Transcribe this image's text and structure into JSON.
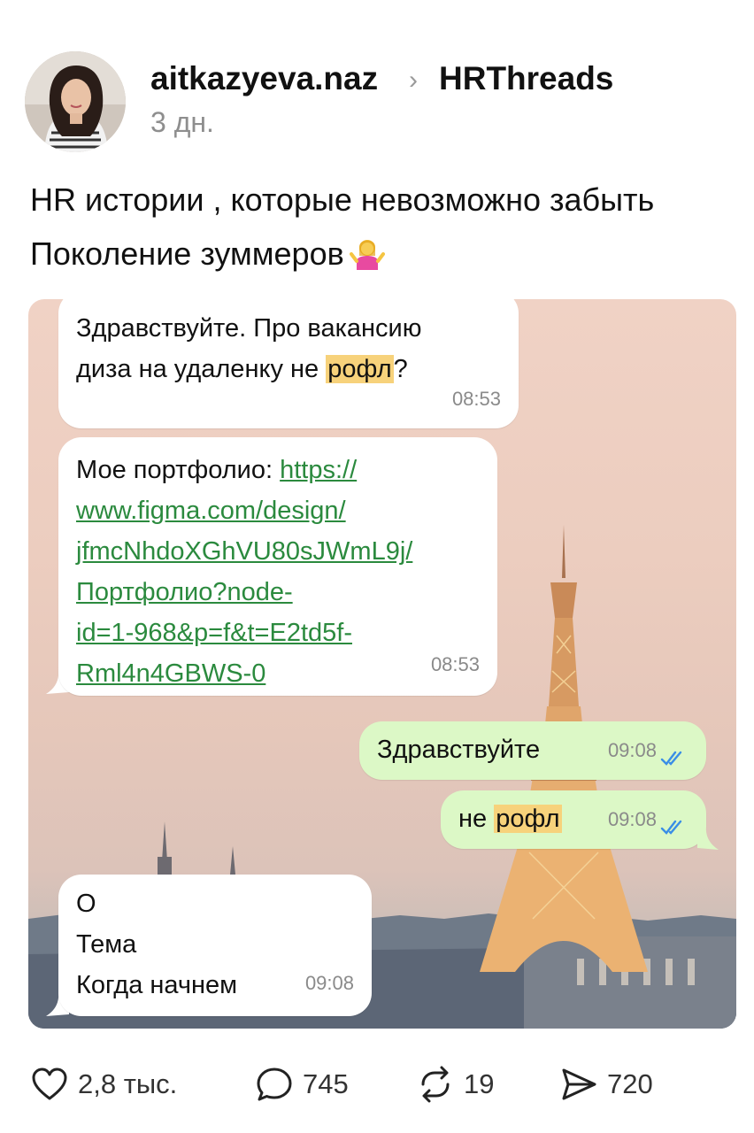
{
  "post": {
    "username": "aitkazyeva.naz",
    "community": "HRThreads",
    "time_ago": "3 дн.",
    "text_line1": "HR истории , которые невозможно забыть",
    "text_line2": "Поколение зуммеров"
  },
  "chat": {
    "msg1": {
      "line1": "Здравствуйте. Про вакансию",
      "line2_pre": "диза на удаленку не ",
      "line2_hl": "рофл",
      "line2_post": "?",
      "time": "08:53"
    },
    "msg2": {
      "label": "Мое портфолио: ",
      "link1": "https://",
      "link2": "www.figma.com/design/",
      "link3": "jfmcNhdoXGhVU80sJWmL9j/",
      "link4": "Портфолио?node-",
      "link5": "id=1-968&p=f&t=E2td5f-",
      "link6": "Rml4n4GBWS-0",
      "time": "08:53"
    },
    "msg3": {
      "text": "Здравствуйте",
      "time": "09:08"
    },
    "msg4": {
      "pre": "не ",
      "hl": "рофл",
      "time": "09:08"
    },
    "msg5": {
      "line1": "О",
      "line2": "Тема",
      "line3": "Когда начнем",
      "time": "09:08"
    }
  },
  "actions": {
    "likes": "2,8 тыс.",
    "comments": "745",
    "reposts": "19",
    "shares": "720"
  },
  "colors": {
    "incoming_bubble": "#ffffff",
    "outgoing_bubble": "#dcf8c6",
    "highlight": "#f7d27b",
    "link": "#2b8a3e",
    "read_ticks": "#3a8ee6"
  }
}
